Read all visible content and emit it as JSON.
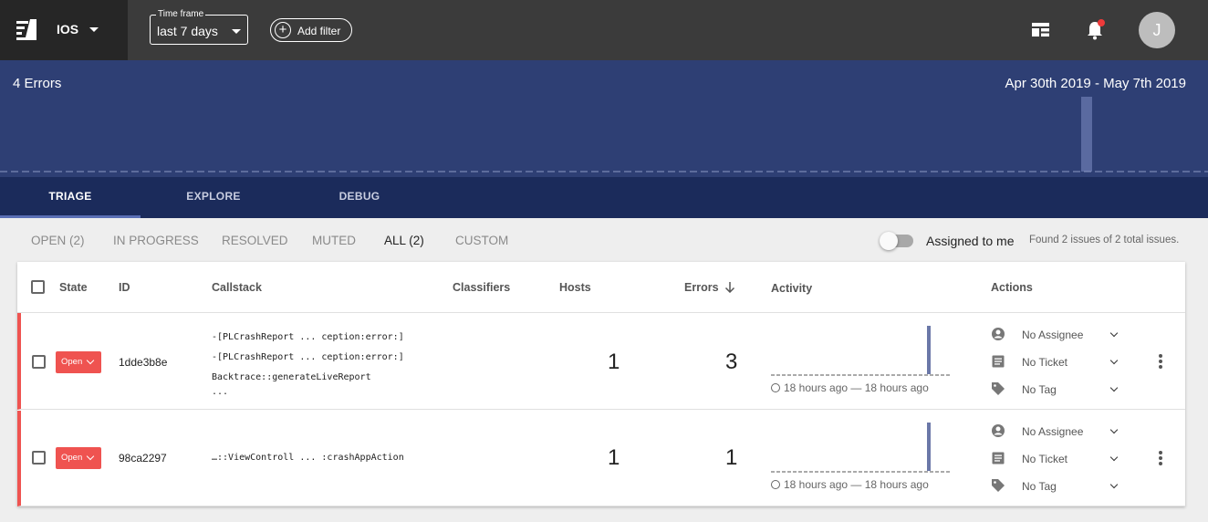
{
  "topbar": {
    "project": "IOS",
    "timeframe_label": "Time frame",
    "timeframe_value": "last 7 days",
    "add_filter": "Add filter",
    "avatar_initial": "J",
    "icons": [
      "logo-icon",
      "layout-icon",
      "bell-icon",
      "caret-down-icon",
      "plus-circle-icon"
    ],
    "notification_dot_color": "#ef3a3a"
  },
  "summary": {
    "error_count": "4 Errors",
    "date_range": "Apr 30th 2019 - May 7th 2019",
    "band_color": "#2e3f74"
  },
  "tabs": [
    {
      "label": "TRIAGE",
      "active": true
    },
    {
      "label": "EXPLORE",
      "active": false
    },
    {
      "label": "DEBUG",
      "active": false
    }
  ],
  "filters": [
    {
      "label": "OPEN (2)",
      "active": false
    },
    {
      "label": "IN PROGRESS",
      "active": false
    },
    {
      "label": "RESOLVED",
      "active": false
    },
    {
      "label": "MUTED",
      "active": false
    },
    {
      "label": "ALL (2)",
      "active": true
    },
    {
      "label": "CUSTOM",
      "active": false
    }
  ],
  "assigned_to_me": {
    "label": "Assigned to me",
    "on": false
  },
  "found_text": "Found 2 issues of 2 total issues.",
  "table": {
    "columns": {
      "state": "State",
      "id": "ID",
      "callstack": "Callstack",
      "classifiers": "Classifiers",
      "hosts": "Hosts",
      "errors": "Errors",
      "activity": "Activity",
      "actions": "Actions"
    },
    "rows": [
      {
        "state": "Open",
        "id": "1dde3b8e",
        "callstack": [
          "-[PLCrashReport ... ception:error:]",
          "-[PLCrashReport ... ception:error:]",
          "Backtrace::generateLiveReport",
          "..."
        ],
        "hosts": "1",
        "errors": "3",
        "activity_time": "18 hours ago — 18 hours ago",
        "assignee": "No Assignee",
        "ticket": "No Ticket",
        "tag": "No Tag"
      },
      {
        "state": "Open",
        "id": "98ca2297",
        "callstack": [
          "…::ViewControll ... :crashAppAction"
        ],
        "hosts": "1",
        "errors": "1",
        "activity_time": "18 hours ago — 18 hours ago",
        "assignee": "No Assignee",
        "ticket": "No Ticket",
        "tag": "No Tag"
      }
    ],
    "state_color": "#ef5350"
  }
}
